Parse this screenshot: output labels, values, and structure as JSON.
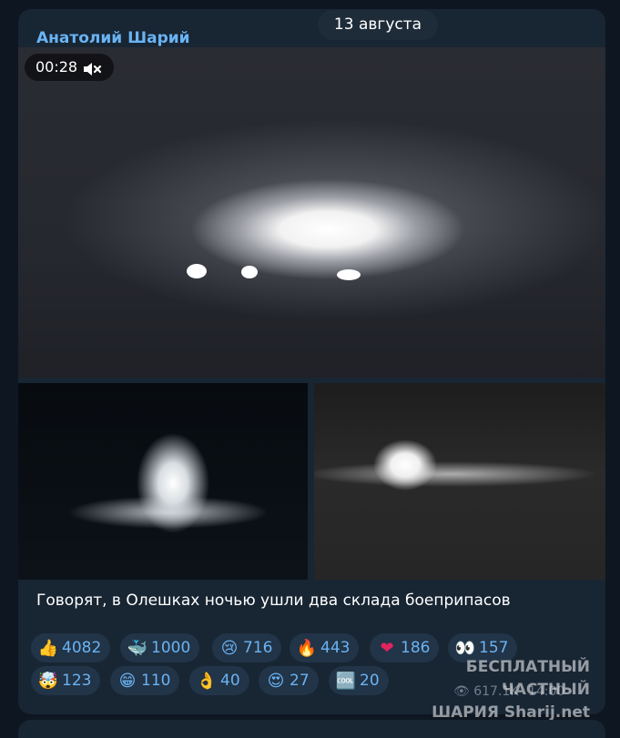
{
  "message": {
    "author": "Анатолий Шарий",
    "date": "13 августа",
    "video": {
      "duration": "00:28",
      "muted": true
    },
    "caption": "Говорят, в Олешках ночью ушли два склада боеприпасов",
    "reactions": [
      {
        "emoji": "👍",
        "emoji_name": "thumbs-up",
        "count": "4082"
      },
      {
        "emoji": "🐳",
        "emoji_name": "whale",
        "count": "1000"
      },
      {
        "emoji": "😢",
        "emoji_name": "crying-face",
        "count": "716"
      },
      {
        "emoji": "🔥",
        "emoji_name": "fire",
        "count": "443"
      },
      {
        "emoji": "❤",
        "emoji_name": "red-heart",
        "count": "186"
      },
      {
        "emoji": "👀",
        "emoji_name": "eyes",
        "count": "157"
      },
      {
        "emoji": "🤯",
        "emoji_name": "exploding-head",
        "count": "123"
      },
      {
        "emoji": "😁",
        "emoji_name": "grinning-face",
        "count": "110"
      },
      {
        "emoji": "👌",
        "emoji_name": "ok-hand",
        "count": "40"
      },
      {
        "emoji": "😍",
        "emoji_name": "heart-eyes",
        "count": "27"
      },
      {
        "emoji": "🆒",
        "emoji_name": "cool-button",
        "count": "20"
      }
    ],
    "views": "617.1K",
    "time": "14:00"
  },
  "watermark": {
    "line1": "БЕСПЛАТНЫЙ ЧАСТНЫЙ",
    "line2": "ШАРИЯ Sharij.net"
  },
  "colors": {
    "background": "#0e1621",
    "bubble": "#182533",
    "accent": "#6ab3f3",
    "reaction_bg": "#223447"
  }
}
